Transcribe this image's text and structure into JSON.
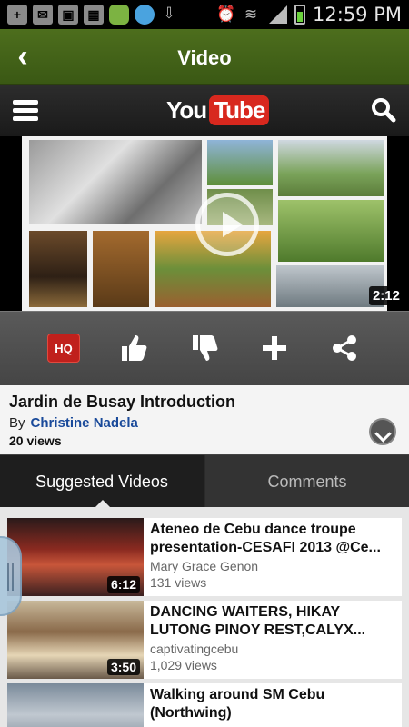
{
  "status_bar": {
    "time": "12:59 PM",
    "icons": [
      "add-icon",
      "mail-icon",
      "image-icon",
      "apps-icon",
      "android-icon",
      "chat-icon",
      "download-icon",
      "alarm-icon",
      "wifi-icon",
      "signal-icon",
      "battery-icon"
    ]
  },
  "app_bar": {
    "title": "Video",
    "back_icon": "back-arrow-icon"
  },
  "youtube_bar": {
    "logo_you": "You",
    "logo_tube": "Tube",
    "menu_icon": "menu-icon",
    "search_icon": "search-icon"
  },
  "player": {
    "duration": "2:12",
    "play_icon": "play-icon"
  },
  "actions": {
    "hq_label": "HQ",
    "items": [
      "hq-button",
      "like-icon",
      "dislike-icon",
      "add-icon",
      "share-icon"
    ]
  },
  "video_info": {
    "title": "Jardin de Busay Introduction",
    "by_label": "By",
    "author": "Christine Nadela",
    "views": "20 views"
  },
  "tabs": [
    {
      "label": "Suggested Videos",
      "active": true
    },
    {
      "label": "Comments",
      "active": false
    }
  ],
  "suggested": [
    {
      "title": "Ateneo de Cebu dance troupe presentation-CESAFI 2013 @Ce...",
      "author": "Mary Grace Genon",
      "views": "131 views",
      "duration": "6:12"
    },
    {
      "title": "DANCING WAITERS, HIKAY LUTONG PINOY REST,CALYX...",
      "author": "captivatingcebu",
      "views": "1,029 views",
      "duration": "3:50"
    },
    {
      "title": "Walking around SM Cebu (Northwing)",
      "author": "",
      "views": "",
      "duration": ""
    }
  ],
  "colors": {
    "app_bar": "#4d6e1d",
    "youtube_red": "#d8281e",
    "author_link": "#1a4a9a"
  }
}
